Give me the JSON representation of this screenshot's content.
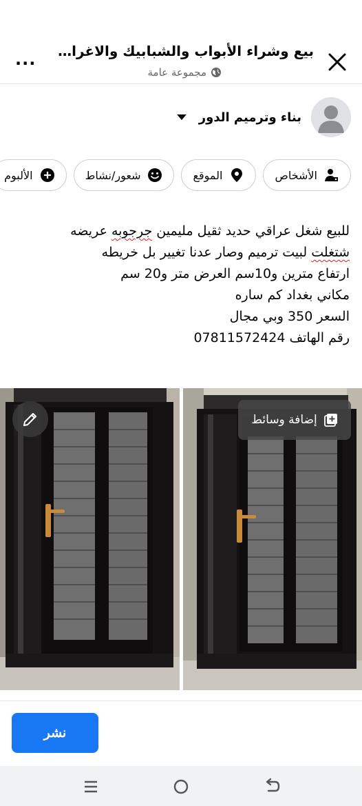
{
  "header": {
    "title": "بيع وشراء الأبواب والشبابيك والاغراض الم...",
    "privacy": "مجموعة عامة",
    "close_icon": "close-icon",
    "more_label": "..."
  },
  "poster": {
    "name": "بناء وترميم الدور"
  },
  "chips": [
    {
      "label": "الأشخاص",
      "icon": "tag-people-icon"
    },
    {
      "label": "الموقع",
      "icon": "location-pin-icon"
    },
    {
      "label": "شعور/نشاط",
      "icon": "smiley-icon"
    },
    {
      "label": "الألبوم",
      "icon": "plus-circle-icon"
    }
  ],
  "post": {
    "line1_a": "للبيع شغل عراقي حديد ثقيل مليمين ",
    "line1_b": "جرجوبه",
    "line1_c": " عريضه",
    "line2_a": "شتغلت",
    "line2_b": " لبيت ترميم وصار عدنا تغيير بل خريطه",
    "line3": "ارتفاع مترين و10سم العرض متر و20 سم",
    "line4": "مكاني بغداد كم ساره",
    "line5": "السعر 350 وبي مجال",
    "line6": "رقم الهاتف 07811572424"
  },
  "media": {
    "add_media_label": "إضافة وسائط"
  },
  "actions": {
    "post_label": "نشر"
  },
  "colors": {
    "primary": "#1877f2",
    "door_dark": "#141212",
    "door_panel": "#6a6a6a",
    "handle": "#c98a3a"
  }
}
